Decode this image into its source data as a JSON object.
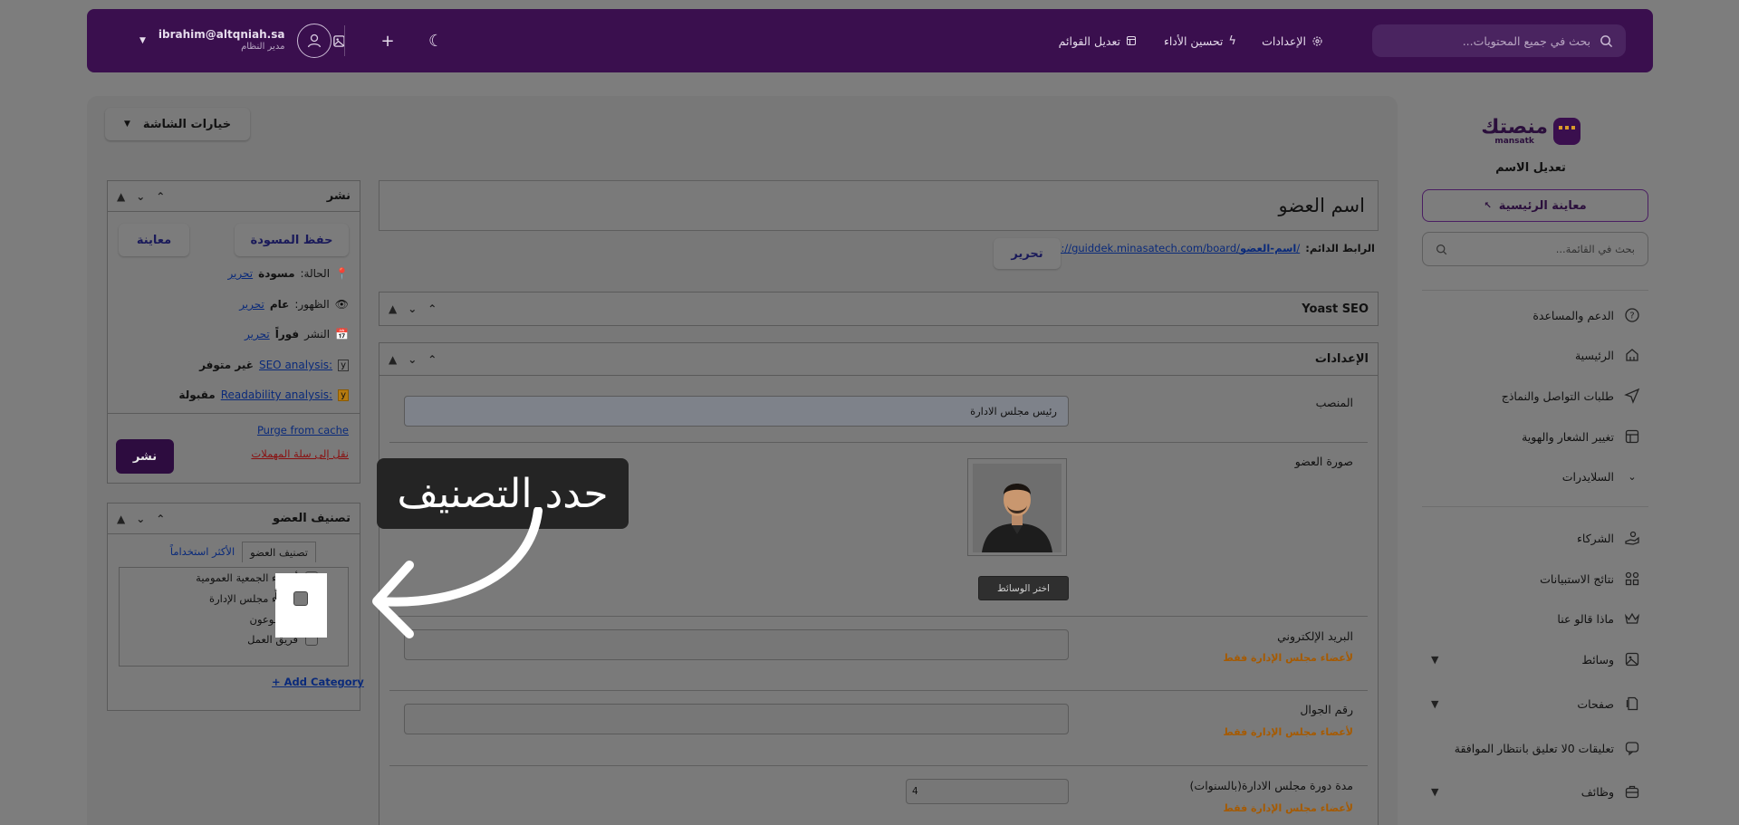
{
  "topbar": {
    "search_placeholder": "بحث في جميع المحتويات...",
    "nav": {
      "settings": "الإعدادات",
      "performance": "تحسين الأداء",
      "menus": "تعديل القوائم"
    },
    "user": {
      "email": "ibrahim@altqniah.sa",
      "role": "مدير النظام"
    }
  },
  "sidebar": {
    "logo_ar": "منصتك",
    "logo_en": "mansatk",
    "title": "تعديل الاسم",
    "preview_label": "معاينة الرئيسية",
    "search_placeholder": "بحث في القائمة...",
    "items": [
      {
        "label": "الدعم والمساعدة",
        "icon": "help-circle-icon"
      },
      {
        "label": "الرئيسية",
        "icon": "home-icon"
      },
      {
        "label": "طلبات التواصل والنماذج",
        "icon": "send-icon"
      },
      {
        "label": "تغيير الشعار والهوية",
        "icon": "layout-icon"
      },
      {
        "label": "السلايدرات",
        "icon": "chevron-down-icon"
      },
      {
        "label": "الشركاء",
        "icon": "handshake-icon"
      },
      {
        "label": "نتائج الاستبيانات",
        "icon": "shapes-icon"
      },
      {
        "label": "ماذا قالو عنا",
        "icon": "crown-icon"
      },
      {
        "label": "وسائط",
        "icon": "image-icon"
      },
      {
        "label": "صفحات",
        "icon": "pages-icon"
      },
      {
        "label": "تعليقات 0لا تعليق بانتظار الموافقة",
        "icon": "comment-icon"
      },
      {
        "label": "وظائف",
        "icon": "briefcase-icon"
      }
    ]
  },
  "screen_options": "خيارات الشاشة",
  "editor": {
    "title": "اسم العضو",
    "permalink_label": "الرابط الدائم:",
    "permalink_base": "https://guiddek.minasatech.com/board/",
    "permalink_slug": "اسم-العضو",
    "permalink_end": "/",
    "edit_button": "تحرير"
  },
  "yoast": {
    "title": "Yoast SEO"
  },
  "settings_box": {
    "title": "الإعدادات",
    "position_label": "المنصب",
    "position_value": "رئيس مجلس الادارة",
    "photo_label": "صورة العضو",
    "media_button": "اختر الوسائط",
    "email_label": "البريد الإلكتروني",
    "phone_label": "رقم الجوال",
    "term_label": "مدة دورة مجلس الادارة(بالسنوات)",
    "term_value": "4",
    "board_only_note": "لأعضاء مجلس الإدارة فقط"
  },
  "publish_box": {
    "title": "نشر",
    "save_draft": "حفظ المسودة",
    "preview": "معاينة",
    "status_label": "الحالة:",
    "status_value": "مسودة",
    "visibility_label": "الظهور:",
    "visibility_value": "عام",
    "publish_label": "النشر",
    "publish_value": "فوراً",
    "edit_link": "تحرير",
    "seo_label": "SEO analysis:",
    "seo_value": "غير متوفر",
    "readability_label": "Readability analysis:",
    "readability_value": "مقبولة",
    "purge": "Purge from cache",
    "trash": "نقل إلى سلة المهملات",
    "publish_button": "نشر"
  },
  "category_box": {
    "title": "تصنيف العضو",
    "tab_all": "تصنيف العضو",
    "tab_popular": "الأكثر استخداماً",
    "items": [
      "أعضاء الجمعية العمومية",
      "أعضاء مجلس الإدارة",
      "المتطوعون",
      "فريق العمل"
    ],
    "add_category": "+ Add Category"
  },
  "tooltip": "حدد التصنيف"
}
